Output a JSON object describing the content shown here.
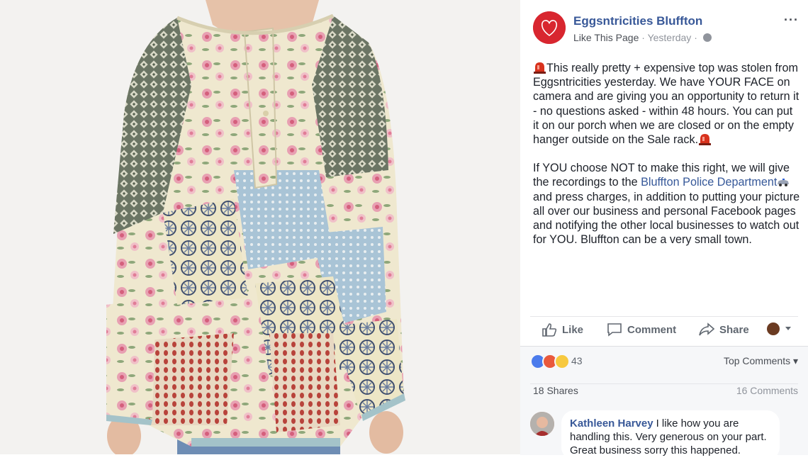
{
  "page": {
    "name": "Eggsntricities Bluffton",
    "like_page": "Like This Page",
    "separator": "·",
    "time": "Yesterday",
    "more": "···"
  },
  "post": {
    "para1": "This really pretty + expensive top was stolen from Eggsntricities yesterday. We have YOUR FACE on camera and are giving you an opportunity to return it - no questions asked - within 48 hours. You can put it on our porch when we are closed or on the empty hanger outside on the Sale rack.",
    "para2_before": "If YOU choose NOT to make this right, we will give the recordings to the ",
    "para2_link": "Bluffton Police Department",
    "para2_after": " and press charges, in addition to putting your picture all over our business and personal Facebook pages and notifying the other local businesses to watch out for YOU. Bluffton can be a very small town."
  },
  "actions": {
    "like": "Like",
    "comment": "Comment",
    "share": "Share"
  },
  "stats": {
    "reaction_count": "43",
    "top_comments": "Top Comments ▾",
    "shares": "18 Shares",
    "comments": "16 Comments"
  },
  "comment": {
    "author": "Kathleen Harvey",
    "text": "I like how you are handling this. Very generous on your part. Great business sorry this happened."
  },
  "colors": {
    "link": "#385898",
    "brand_red": "#d8262f"
  }
}
